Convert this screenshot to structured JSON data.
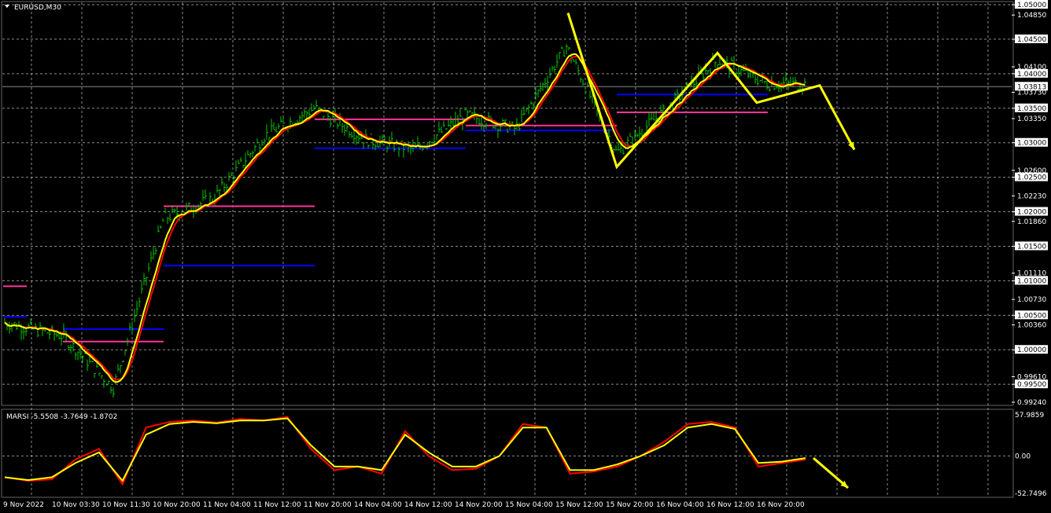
{
  "chart_data": [
    {
      "type": "bar",
      "panel": "price",
      "title": "EURUSD,M30",
      "symbol": "EURUSD",
      "timeframe": "M30",
      "ylim": [
        0.9924,
        1.05
      ],
      "grid": true,
      "colors": {
        "bars": "#00c800",
        "ma_fast": "#ff0000",
        "ma_slow": "#ffff00",
        "support_level": "#0000ff",
        "resistance_level": "#ff3399",
        "projection_arrow": "#ffff00",
        "grid": "#ffffff"
      },
      "y_ticks": [
        "1.05000",
        "1.04850",
        "1.04500",
        "1.04100",
        "1.04000",
        "1.03730",
        "1.03500",
        "1.03350",
        "1.03000",
        "1.02600",
        "1.02500",
        "1.02230",
        "1.02000",
        "1.01860",
        "1.01500",
        "1.01110",
        "1.01000",
        "1.00730",
        "1.00500",
        "1.00360",
        "1.00000",
        "0.99610",
        "0.99500",
        "0.99240"
      ],
      "current_price": "1.03813",
      "x_ticks": [
        "9 Nov 2022",
        "10 Nov 03:30",
        "10 Nov 11:30",
        "10 Nov 20:00",
        "11 Nov 04:00",
        "11 Nov 12:00",
        "11 Nov 20:00",
        "14 Nov 04:00",
        "14 Nov 12:00",
        "14 Nov 20:00",
        "15 Nov 04:00",
        "15 Nov 12:00",
        "15 Nov 20:00",
        "16 Nov 04:00",
        "16 Nov 12:00",
        "16 Nov 20:00"
      ],
      "price_path": [
        {
          "t": "9 Nov 2022",
          "price": 1.004
        },
        {
          "t": "10 Nov 03:30",
          "price": 1.002
        },
        {
          "t": "10 Nov 11:30",
          "price": 0.9945
        },
        {
          "t": "10 Nov 20:00",
          "price": 1.019
        },
        {
          "t": "11 Nov 04:00",
          "price": 1.022
        },
        {
          "t": "11 Nov 12:00",
          "price": 1.031
        },
        {
          "t": "11 Nov 20:00",
          "price": 1.035
        },
        {
          "t": "14 Nov 04:00",
          "price": 1.0305
        },
        {
          "t": "14 Nov 12:00",
          "price": 1.029
        },
        {
          "t": "14 Nov 20:00",
          "price": 1.034
        },
        {
          "t": "15 Nov 04:00",
          "price": 1.032
        },
        {
          "t": "15 Nov 12:00",
          "price": 1.044
        },
        {
          "t": "15 Nov 20:00",
          "price": 1.0285
        },
        {
          "t": "16 Nov 04:00",
          "price": 1.035
        },
        {
          "t": "16 Nov 12:00",
          "price": 1.042
        },
        {
          "t": "16 Nov 20:00",
          "price": 1.0385
        }
      ],
      "levels": [
        {
          "color": "resistance",
          "price": 1.0092,
          "from": "9 Nov 2022",
          "to": "9 Nov 2022"
        },
        {
          "color": "support",
          "price": 1.0048,
          "from": "9 Nov 2022",
          "to": "9 Nov 2022"
        },
        {
          "color": "support",
          "price": 1.003,
          "from": "10 Nov 03:30",
          "to": "10 Nov 20:00"
        },
        {
          "color": "resistance",
          "price": 1.0012,
          "from": "10 Nov 03:30",
          "to": "10 Nov 20:00"
        },
        {
          "color": "resistance",
          "price": 1.0208,
          "from": "10 Nov 20:00",
          "to": "11 Nov 20:00"
        },
        {
          "color": "support",
          "price": 1.0122,
          "from": "10 Nov 20:00",
          "to": "11 Nov 20:00"
        },
        {
          "color": "resistance",
          "price": 1.0334,
          "from": "11 Nov 20:00",
          "to": "14 Nov 20:00"
        },
        {
          "color": "support",
          "price": 1.0292,
          "from": "11 Nov 20:00",
          "to": "14 Nov 20:00"
        },
        {
          "color": "resistance",
          "price": 1.0325,
          "from": "14 Nov 20:00",
          "to": "15 Nov 20:00"
        },
        {
          "color": "support",
          "price": 1.0318,
          "from": "14 Nov 20:00",
          "to": "15 Nov 20:00"
        },
        {
          "color": "support",
          "price": 1.037,
          "from": "15 Nov 20:00",
          "to": "16 Nov 20:00"
        },
        {
          "color": "resistance",
          "price": 1.0344,
          "from": "15 Nov 20:00",
          "to": "16 Nov 20:00"
        }
      ],
      "annotation_zigzag": [
        {
          "t": "15 Nov 04:00",
          "price": 1.0488
        },
        {
          "t": "15 Nov 20:00",
          "price": 1.0265
        },
        {
          "t": "16 Nov 12:00",
          "price": 1.043
        },
        {
          "t": "16 Nov 20:00",
          "price": 1.0358
        },
        {
          "t": "16 Nov 20:00",
          "price": 1.0383
        },
        {
          "t": "16 Nov 20:00",
          "price": 1.029
        }
      ]
    },
    {
      "type": "line",
      "panel": "indicator",
      "title": "MARSI -5.5508 -3.7649 -1.8702",
      "ylim": [
        -52.7496,
        57.9859
      ],
      "y_ticks": [
        "57.9859",
        "0.00",
        "-52.7496"
      ],
      "series": [
        {
          "color": "#ff0000",
          "values": [
            -30,
            -35,
            -33,
            -5,
            10,
            -40,
            40,
            48,
            50,
            47,
            52,
            50,
            55,
            10,
            -20,
            -15,
            -25,
            35,
            0,
            -20,
            -18,
            0,
            45,
            40,
            -25,
            -22,
            -15,
            0,
            20,
            45,
            48,
            40,
            -15,
            -10,
            -5
          ]
        },
        {
          "color": "#ffff00",
          "values": [
            -30,
            -34,
            -30,
            -10,
            5,
            -35,
            30,
            45,
            48,
            46,
            50,
            50,
            53,
            15,
            -15,
            -15,
            -20,
            30,
            5,
            -15,
            -15,
            0,
            40,
            40,
            -20,
            -20,
            -12,
            0,
            15,
            40,
            45,
            38,
            -10,
            -8,
            -3
          ]
        }
      ],
      "annotation_arrow": {
        "from": -3,
        "to": -45
      }
    }
  ]
}
